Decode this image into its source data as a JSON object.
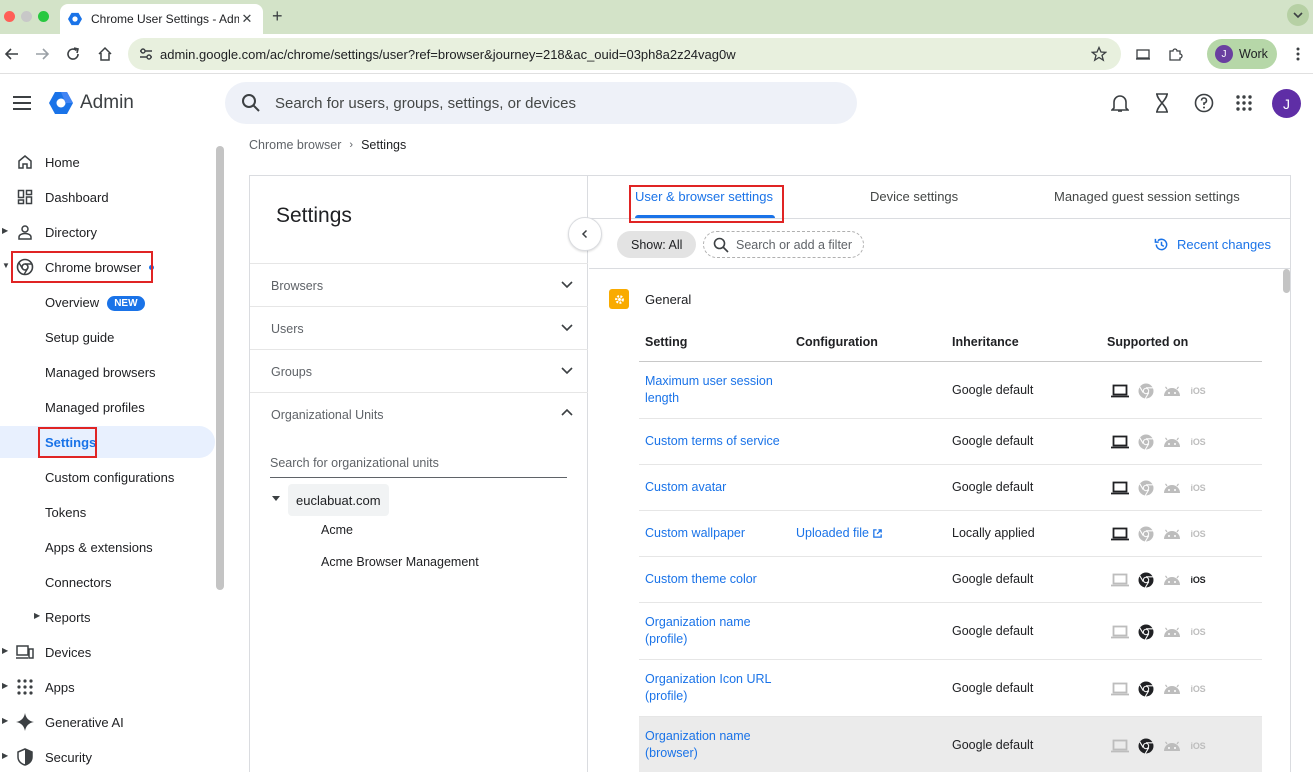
{
  "browser": {
    "tab_title": "Chrome User Settings - Admi",
    "url": "admin.google.com/ac/chrome/settings/user?ref=browser&journey=218&ac_ouid=03ph8a2z24vag0w",
    "profile_label": "Work",
    "profile_initial": "J"
  },
  "header": {
    "app_name": "Admin",
    "search_placeholder": "Search for users, groups, settings, or devices",
    "avatar_initial": "J"
  },
  "sidebar": {
    "items": [
      {
        "label": "Home",
        "icon": "home-icon"
      },
      {
        "label": "Dashboard",
        "icon": "dashboard-icon"
      },
      {
        "label": "Directory",
        "icon": "person-icon"
      },
      {
        "label": "Chrome browser",
        "icon": "chrome-icon"
      },
      {
        "label": "Overview",
        "badge": "NEW"
      },
      {
        "label": "Setup guide"
      },
      {
        "label": "Managed browsers"
      },
      {
        "label": "Managed profiles"
      },
      {
        "label": "Settings"
      },
      {
        "label": "Custom configurations"
      },
      {
        "label": "Tokens"
      },
      {
        "label": "Apps & extensions"
      },
      {
        "label": "Connectors"
      },
      {
        "label": "Reports"
      },
      {
        "label": "Devices",
        "icon": "devices-icon"
      },
      {
        "label": "Apps",
        "icon": "apps-grid-icon"
      },
      {
        "label": "Generative AI",
        "icon": "sparkle-icon"
      },
      {
        "label": "Security",
        "icon": "shield-icon"
      }
    ]
  },
  "breadcrumb": {
    "parent": "Chrome browser",
    "current": "Settings"
  },
  "settings_panel": {
    "title": "Settings",
    "sections": [
      "Browsers",
      "Users",
      "Groups",
      "Organizational Units"
    ],
    "ou_search_placeholder": "Search for organizational units",
    "ou_root": "euclabuat.com",
    "ou_children": [
      "Acme",
      "Acme Browser Management"
    ]
  },
  "tabs": {
    "user_browser": "User & browser settings",
    "device": "Device settings",
    "managed_guest": "Managed guest session settings"
  },
  "filters": {
    "show_chip": "Show: All",
    "search_placeholder": "Search or add a filter",
    "recent_changes": "Recent changes"
  },
  "section": {
    "name": "General",
    "columns": [
      "Setting",
      "Configuration",
      "Inheritance",
      "Supported on"
    ],
    "rows": [
      {
        "name": "Maximum user session length",
        "config": "",
        "inheritance": "Google default"
      },
      {
        "name": "Custom terms of service",
        "config": "",
        "inheritance": "Google default"
      },
      {
        "name": "Custom avatar",
        "config": "",
        "inheritance": "Google default"
      },
      {
        "name": "Custom wallpaper",
        "config": "Uploaded file",
        "inheritance": "Locally applied"
      },
      {
        "name": "Custom theme color",
        "config": "",
        "inheritance": "Google default"
      },
      {
        "name": "Organization name (profile)",
        "config": "",
        "inheritance": "Google default"
      },
      {
        "name": "Organization Icon URL (profile)",
        "config": "",
        "inheritance": "Google default"
      },
      {
        "name": "Organization name (browser)",
        "config": "",
        "inheritance": "Google default"
      }
    ],
    "platform_label_ios": "iOS"
  },
  "colors": {
    "accent": "#1a73e8",
    "highlight_box": "#e02424",
    "general_icon": "#f9ab00"
  }
}
